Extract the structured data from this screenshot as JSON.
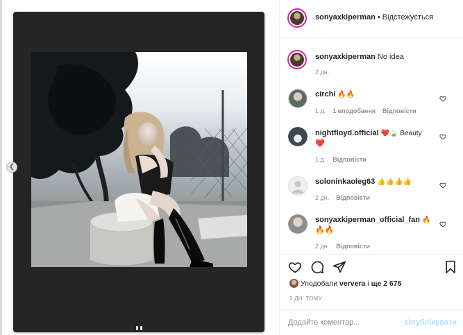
{
  "post": {
    "author": "sonyaxkiperman",
    "follow_status": "• Відстежується",
    "caption": "No idea",
    "caption_age": "2 дн."
  },
  "comments": [
    {
      "user": "circhi",
      "text": "🔥🔥",
      "age": "1 д.",
      "likes": "1 вподобання",
      "reply": "Відповісти"
    },
    {
      "user": "nightfloyd.official",
      "text": "❤️🍃 Beauty",
      "text2": "❤️",
      "age": "1 д.",
      "reply": "Відповісти"
    },
    {
      "user": "soloninkaoleg63",
      "text": "👍👍👍👍",
      "age": "2 дн.",
      "reply": "Відповісти"
    },
    {
      "user": "sonyaxkiperman_official_fan",
      "text": "🔥",
      "text2": "🔥🔥",
      "age": "2 дн.",
      "reply": "Відповісти"
    }
  ],
  "likes": {
    "prefix": "Уподобали",
    "user": "ververa",
    "middle": "і",
    "count": "ще 2 675"
  },
  "post_date": "2 ДН. ТОМУ",
  "comment_input": {
    "placeholder": "Додайте коментар..."
  },
  "publish_label": "Опублікувати",
  "colors": {
    "story_ring": "#d6249f",
    "publish_disabled": "#b2dffc",
    "muted_text": "#8e8e8e",
    "like_red": "#ed4956"
  },
  "icons": {
    "like": "heart-icon",
    "comment": "comment-bubble-icon",
    "share": "paper-plane-icon",
    "save": "bookmark-icon",
    "prev": "chevron-left-icon"
  }
}
